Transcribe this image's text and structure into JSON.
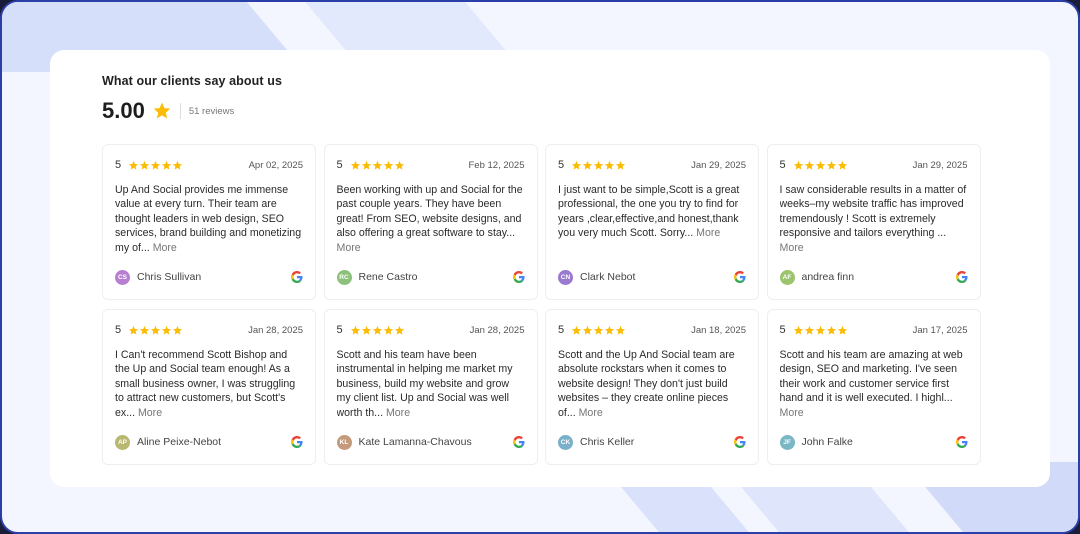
{
  "header": {
    "title": "What our clients say about us",
    "rating": "5.00",
    "review_count": "51 reviews"
  },
  "colors": {
    "star": "#fbbc05",
    "more_link": "#777777"
  },
  "reviews": [
    {
      "score": "5",
      "date": "Apr 02, 2025",
      "text": "Up And Social provides me immense value at every turn. Their team are thought leaders in web design, SEO services, brand building and monetizing my of...",
      "more": "More",
      "initials": "CS",
      "name": "Chris Sullivan",
      "avatar_color": "#b77fd0",
      "source_icon": "google-icon"
    },
    {
      "score": "5",
      "date": "Feb 12, 2025",
      "text": "Been working with up and Social for the past couple years. They have been great! From SEO, website designs, and also offering a great software to stay...",
      "more": "More",
      "initials": "RC",
      "name": "Rene Castro",
      "avatar_color": "#8bc17a",
      "source_icon": "google-icon"
    },
    {
      "score": "5",
      "date": "Jan 29, 2025",
      "text": "I just want to be simple,Scott is a great professional, the one you try to find for years ,clear,effective,and honest,thank you very much Scott. Sorry...",
      "more": "More",
      "initials": "CN",
      "name": "Clark Nebot",
      "avatar_color": "#9a79d0",
      "source_icon": "google-icon"
    },
    {
      "score": "5",
      "date": "Jan 29, 2025",
      "text": "I saw considerable results in a matter of weeks–my website traffic has improved tremendously ! Scott is extremely responsive and tailors everything ...",
      "more": "More",
      "initials": "AF",
      "name": "andrea finn",
      "avatar_color": "#9cc46c",
      "source_icon": "google-icon"
    },
    {
      "score": "5",
      "date": "Jan 28, 2025",
      "text": "I Can't recommend Scott Bishop and the Up and Social team enough! As a small business owner, I was struggling to attract new customers, but Scott's ex...",
      "more": "More",
      "initials": "AP",
      "name": "Aline Peixe-Nebot",
      "avatar_color": "#b8b870",
      "source_icon": "google-icon"
    },
    {
      "score": "5",
      "date": "Jan 28, 2025",
      "text": "Scott and his team have been instrumental in helping me market my business, build my website and grow my client list. Up and Social was well worth th...",
      "more": "More",
      "initials": "KL",
      "name": "Kate Lamanna-Chavous",
      "avatar_color": "#c49a7a",
      "source_icon": "google-icon"
    },
    {
      "score": "5",
      "date": "Jan 18, 2025",
      "text": "Scott and the Up And Social team are absolute rockstars when it comes to website design! They don't just build websites – they create online pieces of...",
      "more": "More",
      "initials": "CK",
      "name": "Chris Keller",
      "avatar_color": "#7ab0c9",
      "source_icon": "google-icon"
    },
    {
      "score": "5",
      "date": "Jan 17, 2025",
      "text": "Scott and his team are amazing at web design, SEO and marketing. I've seen their work and customer service first hand and it is well executed. I highl...",
      "more": "More",
      "initials": "JF",
      "name": "John Falke",
      "avatar_color": "#79b7c4",
      "source_icon": "google-icon"
    }
  ]
}
